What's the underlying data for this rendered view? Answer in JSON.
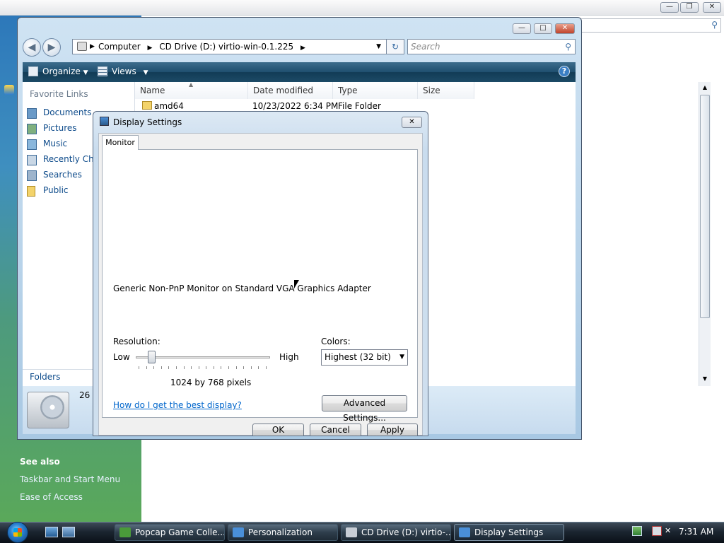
{
  "explorer": {
    "address_segments": [
      "Computer",
      "CD Drive (D:) virtio-win-0.1.225"
    ],
    "search_placeholder": "Search",
    "toolbar": {
      "organize": "Organize",
      "views": "Views"
    },
    "favorite_links_title": "Favorite Links",
    "favorite_links": [
      "Documents",
      "Pictures",
      "Music",
      "Recently Cha",
      "Searches",
      "Public"
    ],
    "folders_label": "Folders",
    "columns": [
      "Name",
      "Date modified",
      "Type",
      "Size"
    ],
    "rows": [
      {
        "name": "amd64",
        "date": "10/23/2022 6:34 PM",
        "type": "File Folder",
        "size": ""
      }
    ],
    "details_count": "26"
  },
  "background": {
    "see_also_title": "See also",
    "see_also_links": [
      "Taskbar and Start Menu",
      "Ease of Access"
    ]
  },
  "dialog": {
    "title": "Display Settings",
    "tab": "Monitor",
    "monitor_name": "Generic Non-PnP Monitor on Standard VGA Graphics Adapter",
    "resolution_label": "Resolution:",
    "low_label": "Low",
    "high_label": "High",
    "resolution_value": "1024 by 768 pixels",
    "slider_level": 0.1,
    "colors_label": "Colors:",
    "colors_value": "Highest (32 bit)",
    "help_link": "How do I get the best display?",
    "advanced_button": "Advanced Settings...",
    "ok_button": "OK",
    "cancel_button": "Cancel",
    "apply_button": "Apply"
  },
  "taskbar": {
    "buttons": [
      {
        "label": "Popcap Game Colle..."
      },
      {
        "label": "Personalization"
      },
      {
        "label": "CD Drive (D:) virtio-..."
      },
      {
        "label": "Display Settings"
      }
    ],
    "clock": "7:31 AM"
  },
  "colors": {
    "link": "#0066cc",
    "toolbar": "#1f4f6f"
  }
}
